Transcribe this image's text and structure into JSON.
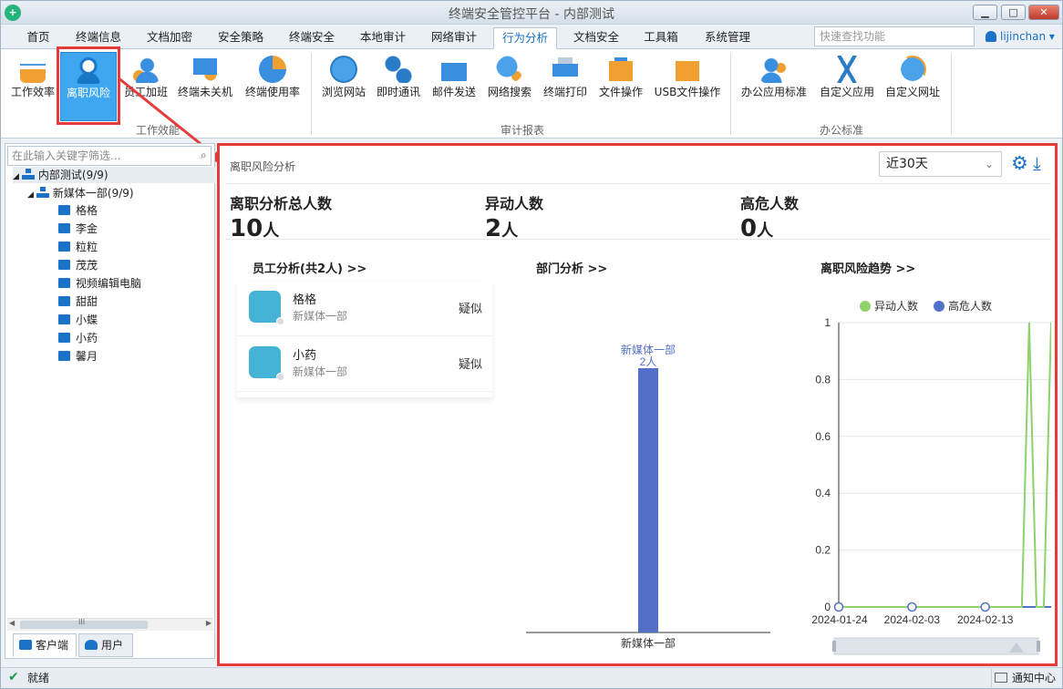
{
  "window": {
    "title": "终端安全管控平台 - 内部测试",
    "logo": "shield-logo",
    "min": "▁",
    "max": "□",
    "close": "✕"
  },
  "menu": {
    "tabs": [
      "首页",
      "终端信息",
      "文档加密",
      "安全策略",
      "终端安全",
      "本地审计",
      "网络审计",
      "行为分析",
      "文档安全",
      "工具箱",
      "系统管理"
    ],
    "active_tab": "行为分析",
    "quick_search_placeholder": "快速查找功能",
    "user": "lijinchan"
  },
  "ribbon": {
    "group1": {
      "label": "工作效能",
      "items": [
        "工作效率",
        "离职风险",
        "员工加班",
        "终端未关机",
        "终端使用率"
      ]
    },
    "group2": {
      "label": "审计报表",
      "items": [
        "浏览网站",
        "即时通讯",
        "邮件发送",
        "网络搜索",
        "终端打印",
        "文件操作",
        "USB文件操作"
      ]
    },
    "group3": {
      "label": "办公标准",
      "items": [
        "办公应用标准",
        "自定义应用",
        "自定义网址"
      ]
    },
    "selected": "离职风险"
  },
  "tree": {
    "search_placeholder": "在此输入关键字筛选...",
    "root": "内部测试(9/9)",
    "group": "新媒体一部(9/9)",
    "computers": [
      "格格",
      "李金",
      "粒粒",
      "茂茂",
      "视频编辑电脑",
      "甜甜",
      "小蝶",
      "小药",
      "馨月"
    ],
    "scroll_label": "III",
    "bottom_tabs": [
      "客户端",
      "用户"
    ]
  },
  "main": {
    "title": "离职风险分析",
    "range": "近30天",
    "stats": [
      {
        "label": "离职分析总人数",
        "value": "10",
        "unit": "人"
      },
      {
        "label": "异动人数",
        "value": "2",
        "unit": "人"
      },
      {
        "label": "高危人数",
        "value": "0",
        "unit": "人"
      }
    ],
    "sections": {
      "employee": "员工分析(共2人) >>",
      "dept": "部门分析 >>",
      "trend": "离职风险趋势 >>"
    },
    "employees": [
      {
        "name": "格格",
        "dept": "新媒体一部",
        "status": "疑似"
      },
      {
        "name": "小药",
        "dept": "新媒体一部",
        "status": "疑似"
      }
    ]
  },
  "chart_data": [
    {
      "type": "bar",
      "categories": [
        "新媒体一部"
      ],
      "values": [
        2
      ],
      "data_labels": [
        "新媒体一部",
        "2人"
      ],
      "ylim": [
        0,
        2.4
      ]
    },
    {
      "type": "line",
      "legend": [
        "异动人数",
        "高危人数"
      ],
      "legend_position": "top",
      "x_ticks": [
        "2024-01-24",
        "2024-02-03",
        "2024-02-13"
      ],
      "y_ticks": [
        "0",
        "0.2",
        "0.4",
        "0.6",
        "0.8",
        "1"
      ],
      "ylim": [
        0,
        1
      ],
      "grid": true,
      "series": [
        {
          "name": "异动人数",
          "color": "#8fd16a",
          "x": [
            "2024-01-24",
            "2024-02-03",
            "2024-02-13",
            "2024-02-18",
            "2024-02-19",
            "2024-02-20",
            "2024-02-21",
            "2024-02-22"
          ],
          "values": [
            0,
            0,
            0,
            0,
            1,
            0,
            0,
            1
          ]
        },
        {
          "name": "高危人数",
          "color": "#5470c6",
          "x": [
            "2024-01-24",
            "2024-02-03",
            "2024-02-13",
            "2024-02-22"
          ],
          "values": [
            0,
            0,
            0,
            0
          ]
        }
      ]
    }
  ],
  "status": {
    "text": "就绪",
    "notify": "通知中心"
  }
}
